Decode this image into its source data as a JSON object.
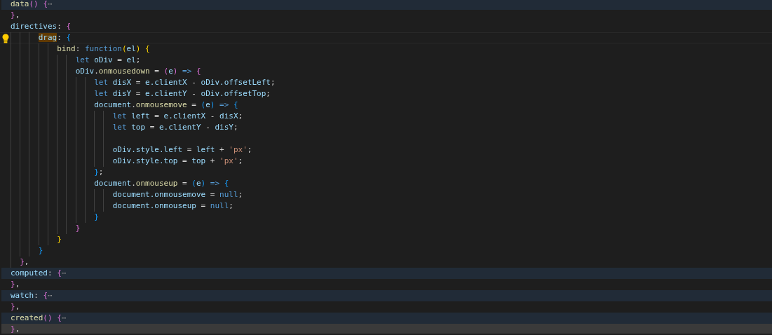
{
  "editor": {
    "lines": [
      {
        "folded": true,
        "tokens": [
          {
            "text": "data",
            "kind": "function"
          },
          {
            "text": "() ",
            "kind": "bracket2"
          },
          {
            "text": "{",
            "kind": "bracket2"
          },
          {
            "text": "⋯",
            "kind": "fold"
          }
        ]
      },
      {
        "tokens": [
          {
            "text": "}",
            "kind": "bracket2"
          },
          {
            "text": ",",
            "kind": "plain"
          }
        ]
      },
      {
        "tokens": [
          {
            "text": "directives",
            "kind": "variable"
          },
          {
            "text": ": ",
            "kind": "plain"
          },
          {
            "text": "{",
            "kind": "bracket2"
          }
        ]
      },
      {
        "current": true,
        "lightbulb": true,
        "tokens": [
          {
            "text": "      drag",
            "kind": "variable",
            "highlight": true
          },
          {
            "text": ": ",
            "kind": "plain"
          },
          {
            "text": "{",
            "kind": "bracket3"
          }
        ]
      },
      {
        "tokens": [
          {
            "text": "          bind",
            "kind": "function"
          },
          {
            "text": ": ",
            "kind": "plain"
          },
          {
            "text": "function",
            "kind": "keyword"
          },
          {
            "text": "(",
            "kind": "bracket1"
          },
          {
            "text": "el",
            "kind": "variable"
          },
          {
            "text": ") ",
            "kind": "bracket1"
          },
          {
            "text": "{",
            "kind": "bracket1"
          }
        ]
      },
      {
        "tokens": [
          {
            "text": "              let ",
            "kind": "keyword"
          },
          {
            "text": "oDiv",
            "kind": "variable"
          },
          {
            "text": " = ",
            "kind": "plain"
          },
          {
            "text": "el",
            "kind": "variable"
          },
          {
            "text": ";",
            "kind": "plain"
          }
        ]
      },
      {
        "tokens": [
          {
            "text": "              oDiv",
            "kind": "variable"
          },
          {
            "text": ".",
            "kind": "plain"
          },
          {
            "text": "onmousedown",
            "kind": "function"
          },
          {
            "text": " = ",
            "kind": "plain"
          },
          {
            "text": "(",
            "kind": "bracket2"
          },
          {
            "text": "e",
            "kind": "variable"
          },
          {
            "text": ") ",
            "kind": "bracket2"
          },
          {
            "text": "=> ",
            "kind": "keyword"
          },
          {
            "text": "{",
            "kind": "bracket2"
          }
        ]
      },
      {
        "tokens": [
          {
            "text": "                  let ",
            "kind": "keyword"
          },
          {
            "text": "disX",
            "kind": "variable"
          },
          {
            "text": " = ",
            "kind": "plain"
          },
          {
            "text": "e.clientX",
            "kind": "variable"
          },
          {
            "text": " - ",
            "kind": "plain"
          },
          {
            "text": "oDiv.offsetLeft",
            "kind": "variable"
          },
          {
            "text": ";",
            "kind": "plain"
          }
        ]
      },
      {
        "tokens": [
          {
            "text": "                  let ",
            "kind": "keyword"
          },
          {
            "text": "disY",
            "kind": "variable"
          },
          {
            "text": " = ",
            "kind": "plain"
          },
          {
            "text": "e.clientY",
            "kind": "variable"
          },
          {
            "text": " - ",
            "kind": "plain"
          },
          {
            "text": "oDiv.offsetTop",
            "kind": "variable"
          },
          {
            "text": ";",
            "kind": "plain"
          }
        ]
      },
      {
        "tokens": [
          {
            "text": "                  document",
            "kind": "variable"
          },
          {
            "text": ".",
            "kind": "plain"
          },
          {
            "text": "onmousemove",
            "kind": "function"
          },
          {
            "text": " = ",
            "kind": "plain"
          },
          {
            "text": "(",
            "kind": "bracket3"
          },
          {
            "text": "e",
            "kind": "variable"
          },
          {
            "text": ") ",
            "kind": "bracket3"
          },
          {
            "text": "=> ",
            "kind": "keyword"
          },
          {
            "text": "{",
            "kind": "bracket3"
          }
        ]
      },
      {
        "tokens": [
          {
            "text": "                      let ",
            "kind": "keyword"
          },
          {
            "text": "left",
            "kind": "variable"
          },
          {
            "text": " = ",
            "kind": "plain"
          },
          {
            "text": "e.clientX",
            "kind": "variable"
          },
          {
            "text": " - ",
            "kind": "plain"
          },
          {
            "text": "disX",
            "kind": "variable"
          },
          {
            "text": ";",
            "kind": "plain"
          }
        ]
      },
      {
        "tokens": [
          {
            "text": "                      let ",
            "kind": "keyword"
          },
          {
            "text": "top",
            "kind": "variable"
          },
          {
            "text": " = ",
            "kind": "plain"
          },
          {
            "text": "e.clientY",
            "kind": "variable"
          },
          {
            "text": " - ",
            "kind": "plain"
          },
          {
            "text": "disY",
            "kind": "variable"
          },
          {
            "text": ";",
            "kind": "plain"
          }
        ]
      },
      {
        "kind": "blank"
      },
      {
        "tokens": [
          {
            "text": "                      oDiv.style.left",
            "kind": "variable"
          },
          {
            "text": " = ",
            "kind": "plain"
          },
          {
            "text": "left",
            "kind": "variable"
          },
          {
            "text": " + ",
            "kind": "plain"
          },
          {
            "text": "'px'",
            "kind": "string"
          },
          {
            "text": ";",
            "kind": "plain"
          }
        ]
      },
      {
        "tokens": [
          {
            "text": "                      oDiv.style.top",
            "kind": "variable"
          },
          {
            "text": " = ",
            "kind": "plain"
          },
          {
            "text": "top",
            "kind": "variable"
          },
          {
            "text": " + ",
            "kind": "plain"
          },
          {
            "text": "'px'",
            "kind": "string"
          },
          {
            "text": ";",
            "kind": "plain"
          }
        ]
      },
      {
        "tokens": [
          {
            "text": "                  }",
            "kind": "bracket3"
          },
          {
            "text": ";",
            "kind": "plain"
          }
        ]
      },
      {
        "tokens": [
          {
            "text": "                  document",
            "kind": "variable"
          },
          {
            "text": ".",
            "kind": "plain"
          },
          {
            "text": "onmouseup",
            "kind": "function"
          },
          {
            "text": " = ",
            "kind": "plain"
          },
          {
            "text": "(",
            "kind": "bracket3"
          },
          {
            "text": "e",
            "kind": "variable"
          },
          {
            "text": ") ",
            "kind": "bracket3"
          },
          {
            "text": "=> ",
            "kind": "keyword"
          },
          {
            "text": "{",
            "kind": "bracket3"
          }
        ]
      },
      {
        "tokens": [
          {
            "text": "                      document.onmousemove",
            "kind": "variable"
          },
          {
            "text": " = ",
            "kind": "plain"
          },
          {
            "text": "null",
            "kind": "keyword"
          },
          {
            "text": ";",
            "kind": "plain"
          }
        ]
      },
      {
        "tokens": [
          {
            "text": "                      document.onmouseup",
            "kind": "variable"
          },
          {
            "text": " = ",
            "kind": "plain"
          },
          {
            "text": "null",
            "kind": "keyword"
          },
          {
            "text": ";",
            "kind": "plain"
          }
        ]
      },
      {
        "tokens": [
          {
            "text": "                  }",
            "kind": "bracket3"
          }
        ]
      },
      {
        "tokens": [
          {
            "text": "              }",
            "kind": "bracket2"
          }
        ]
      },
      {
        "tokens": [
          {
            "text": "          }",
            "kind": "bracket1"
          }
        ]
      },
      {
        "tokens": [
          {
            "text": "      }",
            "kind": "bracket3"
          }
        ]
      },
      {
        "tokens": [
          {
            "text": "  }",
            "kind": "bracket2"
          },
          {
            "text": ",",
            "kind": "plain"
          }
        ]
      },
      {
        "folded": true,
        "tokens": [
          {
            "text": "computed",
            "kind": "variable"
          },
          {
            "text": ": ",
            "kind": "plain"
          },
          {
            "text": "{",
            "kind": "bracket2"
          },
          {
            "text": "⋯",
            "kind": "fold"
          }
        ]
      },
      {
        "tokens": [
          {
            "text": "}",
            "kind": "bracket2"
          },
          {
            "text": ",",
            "kind": "plain"
          }
        ]
      },
      {
        "folded": true,
        "tokens": [
          {
            "text": "watch",
            "kind": "variable"
          },
          {
            "text": ": ",
            "kind": "plain"
          },
          {
            "text": "{",
            "kind": "bracket2"
          },
          {
            "text": "⋯",
            "kind": "fold"
          }
        ]
      },
      {
        "tokens": [
          {
            "text": "}",
            "kind": "bracket2"
          },
          {
            "text": ",",
            "kind": "plain"
          }
        ]
      },
      {
        "folded": true,
        "tokens": [
          {
            "text": "created",
            "kind": "function"
          },
          {
            "text": "() ",
            "kind": "bracket2"
          },
          {
            "text": "{",
            "kind": "bracket2"
          },
          {
            "text": "⋯",
            "kind": "fold"
          }
        ]
      },
      {
        "tokens": [
          {
            "text": "}",
            "kind": "bracket2"
          },
          {
            "text": ",",
            "kind": "plain"
          }
        ]
      }
    ]
  }
}
